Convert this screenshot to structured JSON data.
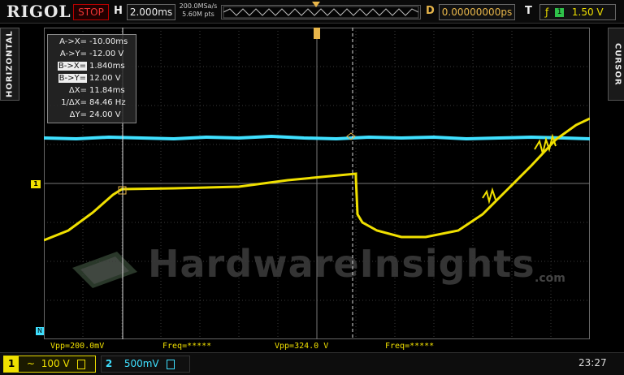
{
  "topbar": {
    "brand": "RIGOL",
    "run_state": "STOP",
    "h_label": "H",
    "timebase": "2.000ms",
    "sample_rate": "200.0MSa/s",
    "mem_depth": "5.60M pts",
    "d_label": "D",
    "delay": "0.00000000ps",
    "t_label": "T",
    "trigger_level": "1.50 V"
  },
  "side_tabs": {
    "left": "HORIZONTAL",
    "right": "CURSOR"
  },
  "cursor_panel": {
    "rows": [
      {
        "key": "A->X=",
        "value": "-10.00ms",
        "boxed": false
      },
      {
        "key": "A->Y=",
        "value": "-12.00 V",
        "boxed": false
      },
      {
        "key": "B->X=",
        "value": "1.840ms",
        "boxed": true
      },
      {
        "key": "B->Y=",
        "value": "12.00 V",
        "boxed": true
      },
      {
        "key": "ΔX=",
        "value": "11.84ms",
        "boxed": false
      },
      {
        "key": "1/ΔX=",
        "value": "84.46 Hz",
        "boxed": false
      },
      {
        "key": "ΔY=",
        "value": "24.00 V",
        "boxed": false
      }
    ]
  },
  "measurements": {
    "ch1_vpp": "Vpp=200.0mV",
    "ch1_freq": "Freq=*****",
    "ch2_vpp": "Vpp=324.0 V",
    "ch2_freq": "Freq=*****"
  },
  "channels": {
    "ch1": {
      "num": "1",
      "coupling": "~",
      "scale": "100 V",
      "color": "#f0e000"
    },
    "ch2": {
      "num": "2",
      "scale": "500mV",
      "color": "#3fe0ff"
    }
  },
  "clock": "23:27",
  "watermark": {
    "text": "HardwareInsights",
    "suffix": ".com"
  },
  "colors": {
    "ch1": "#f0e000",
    "ch2": "#3fe0ff",
    "stop": "#e33",
    "delay": "#e8b64a"
  }
}
